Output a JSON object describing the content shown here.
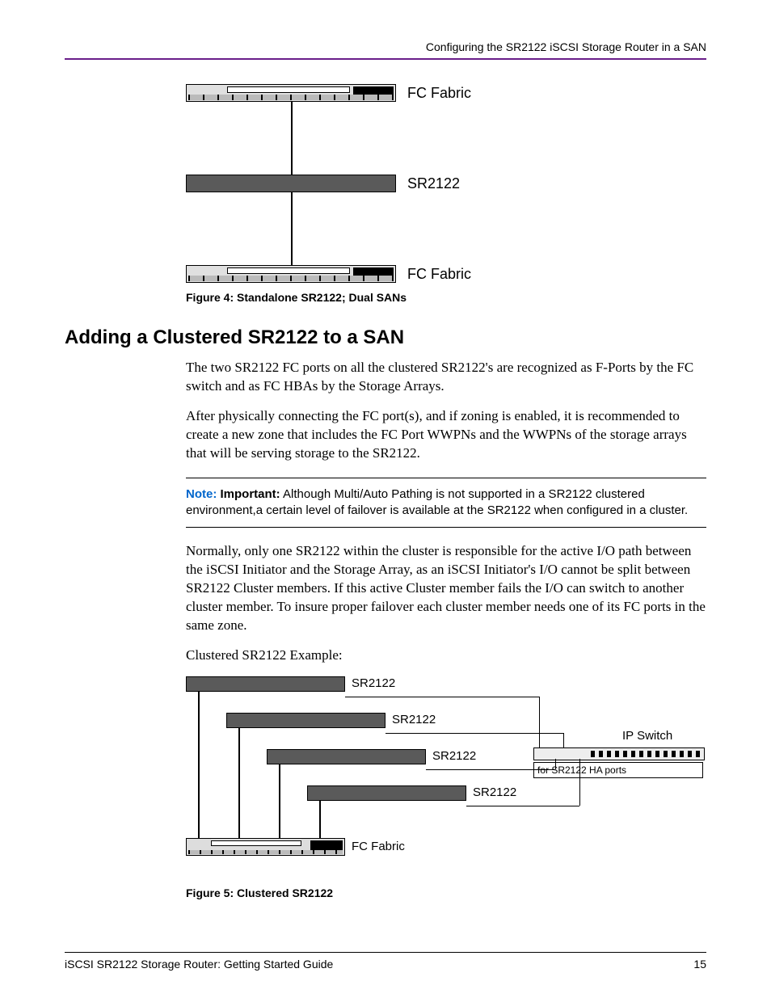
{
  "header": {
    "running_title": "Configuring the SR2122 iSCSI Storage Router in a SAN"
  },
  "figure4": {
    "labels": {
      "top": "FC Fabric",
      "middle": "SR2122",
      "bottom": "FC Fabric"
    },
    "caption": "Figure 4:  Standalone SR2122; Dual SANs"
  },
  "section": {
    "heading": "Adding a Clustered SR2122 to a SAN",
    "para1": "The two SR2122 FC ports on all the clustered SR2122's are recognized as F-Ports by the FC switch and as FC HBAs by the Storage Arrays.",
    "para2": "After physically connecting the FC port(s), and if zoning is enabled, it is recommended to create a new zone that includes the FC Port WWPNs and the WWPNs of the storage arrays that will be serving storage to the SR2122.",
    "note": {
      "label": "Note:",
      "important": "Important:",
      "text": "Although Multi/Auto Pathing is not supported in a SR2122 clustered environment,a certain level of failover is available at the SR2122 when configured in a cluster."
    },
    "para3": "Normally, only one SR2122 within the cluster is responsible for the active I/O path between the iSCSI Initiator and the Storage Array, as an iSCSI Initiator's I/O cannot be split between SR2122 Cluster members. If this active Cluster member fails the I/O can switch to another cluster member. To insure proper failover each cluster member needs one of its FC ports in the same zone.",
    "example_intro": " Clustered SR2122 Example:"
  },
  "figure5": {
    "labels": {
      "sr1": "SR2122",
      "sr2": "SR2122",
      "sr3": "SR2122",
      "sr4": "SR2122",
      "fc": "FC Fabric",
      "ip_switch": "IP Switch",
      "ip_note": "for SR2122 HA ports"
    },
    "caption": "Figure 5:  Clustered SR2122"
  },
  "footer": {
    "left": "iSCSI SR2122 Storage Router: Getting Started Guide",
    "page": "15"
  }
}
